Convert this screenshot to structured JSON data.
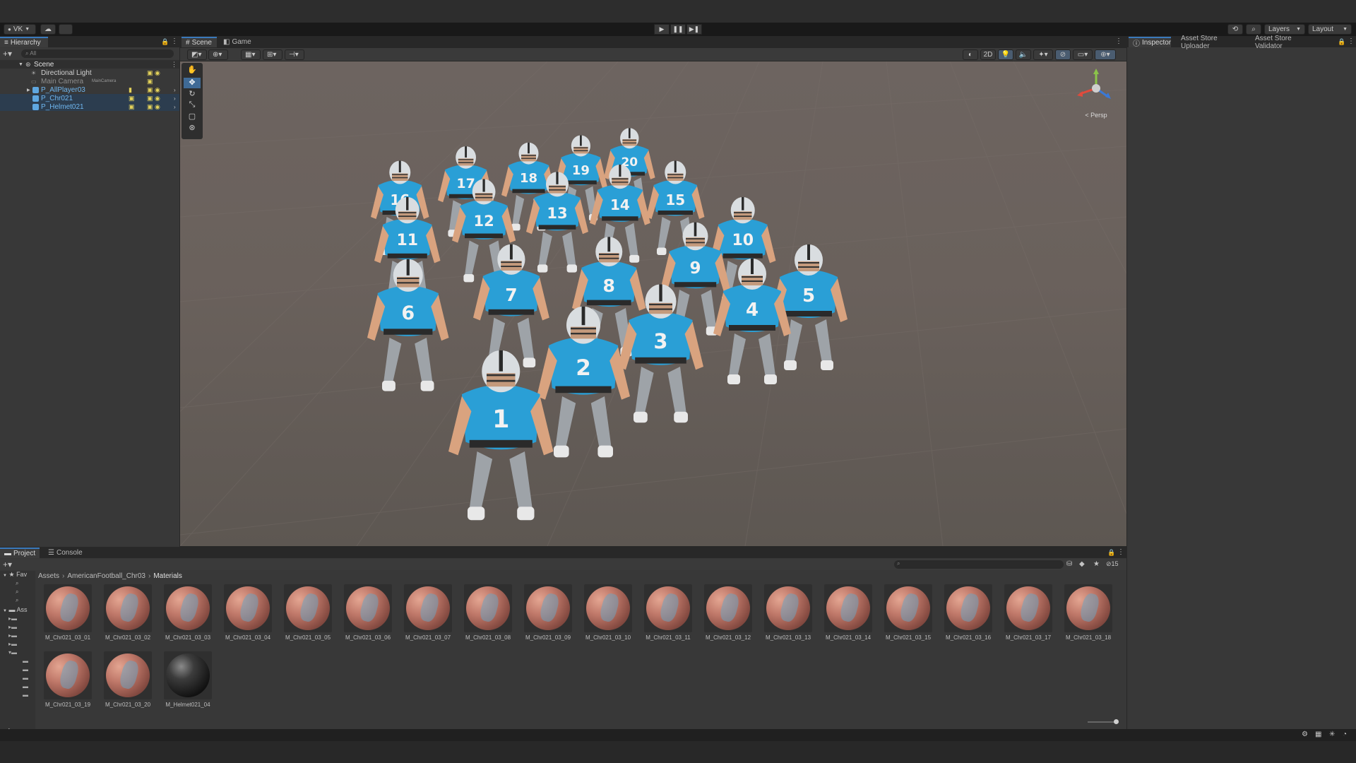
{
  "toolbar": {
    "account_label": "VK",
    "layers_label": "Layers",
    "layout_label": "Layout",
    "play_icon": "play-icon",
    "pause_icon": "pause-icon",
    "step_icon": "step-icon"
  },
  "hierarchy": {
    "tab_label": "Hierarchy",
    "search_placeholder": "All",
    "scene_name": "Scene",
    "items": [
      {
        "label": "Directional Light",
        "tag": ""
      },
      {
        "label": "Main Camera",
        "tag": "MainCamera"
      },
      {
        "label": "P_AllPlayer03",
        "tag": ""
      },
      {
        "label": "P_Chr021",
        "tag": ""
      },
      {
        "label": "P_Helmet021",
        "tag": ""
      }
    ]
  },
  "scene_view": {
    "tabs": [
      {
        "label": "Scene"
      },
      {
        "label": "Game"
      }
    ],
    "toggle_2d": "2D",
    "gizmo_label": "< Persp",
    "jersey_numbers": [
      "1",
      "2",
      "3",
      "4",
      "5",
      "6",
      "7",
      "8",
      "9",
      "10",
      "11",
      "12",
      "13",
      "14",
      "15",
      "16",
      "17",
      "18",
      "19",
      "20"
    ]
  },
  "inspector": {
    "tabs": [
      {
        "label": "Inspector"
      },
      {
        "label": "Asset Store Uploader"
      },
      {
        "label": "Asset Store Validator"
      }
    ]
  },
  "project": {
    "tabs": [
      {
        "label": "Project"
      },
      {
        "label": "Console"
      }
    ],
    "favorites_label": "Fav",
    "assets_label": "Ass",
    "breadcrumb": [
      "Assets",
      "AmericanFootball_Chr03",
      "Materials"
    ],
    "count_label": "15",
    "assets": [
      {
        "name": "M_Chr021_03_01"
      },
      {
        "name": "M_Chr021_03_02"
      },
      {
        "name": "M_Chr021_03_03"
      },
      {
        "name": "M_Chr021_03_04"
      },
      {
        "name": "M_Chr021_03_05"
      },
      {
        "name": "M_Chr021_03_06"
      },
      {
        "name": "M_Chr021_03_07"
      },
      {
        "name": "M_Chr021_03_08"
      },
      {
        "name": "M_Chr021_03_09"
      },
      {
        "name": "M_Chr021_03_10"
      },
      {
        "name": "M_Chr021_03_11"
      },
      {
        "name": "M_Chr021_03_12"
      },
      {
        "name": "M_Chr021_03_13"
      },
      {
        "name": "M_Chr021_03_14"
      },
      {
        "name": "M_Chr021_03_15"
      },
      {
        "name": "M_Chr021_03_16"
      },
      {
        "name": "M_Chr021_03_17"
      },
      {
        "name": "M_Chr021_03_18"
      },
      {
        "name": "M_Chr021_03_19"
      },
      {
        "name": "M_Chr021_03_20"
      },
      {
        "name": "M_Helmet021_04"
      }
    ]
  },
  "colors": {
    "accent": "#3a79bb",
    "jersey": "#2a9fd6",
    "selected_text": "#6fb6ef"
  }
}
